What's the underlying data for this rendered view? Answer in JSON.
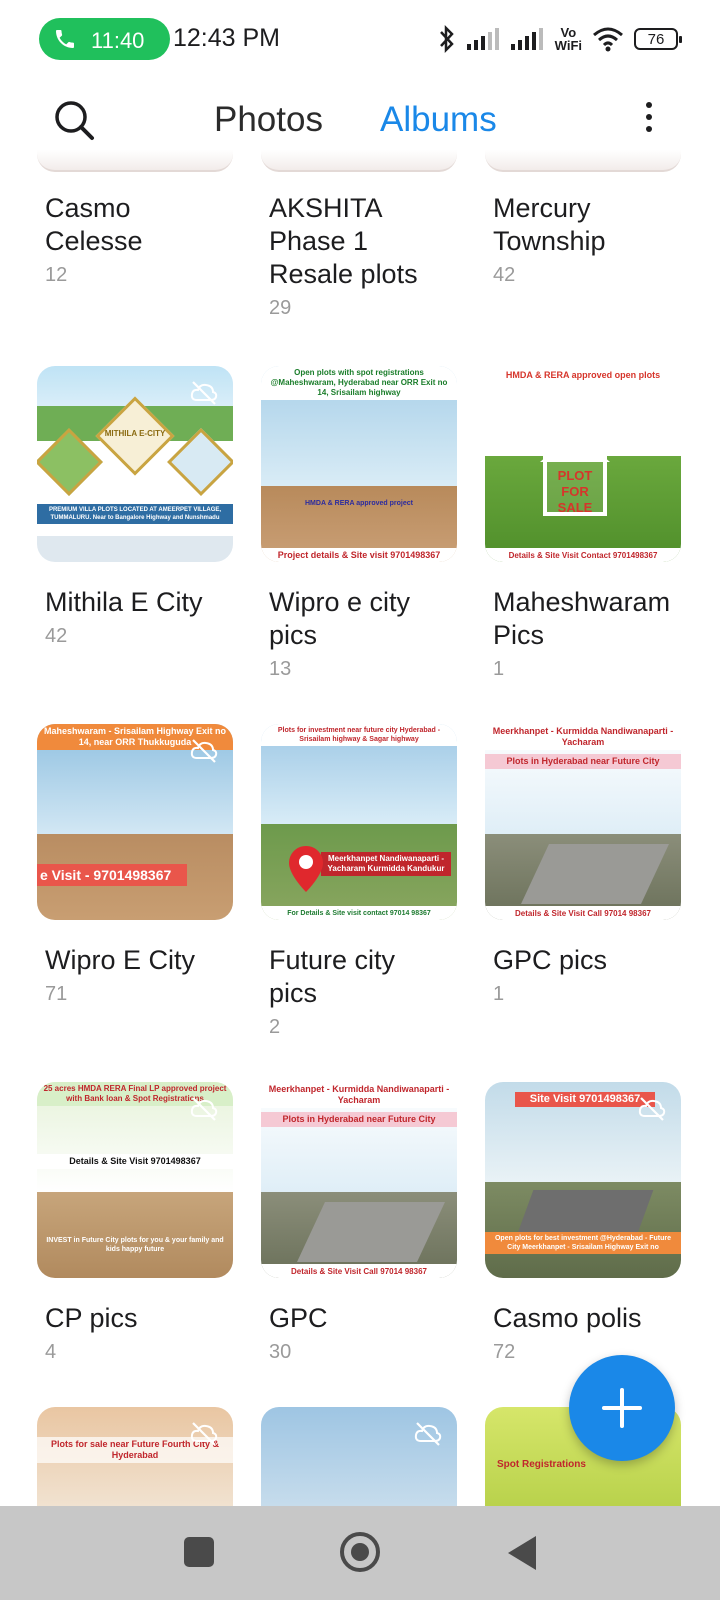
{
  "status_bar": {
    "call_time": "11:40",
    "clock": "12:43 PM",
    "vowifi_top": "Vo",
    "vowifi_bottom": "WiFi",
    "battery": "76"
  },
  "header": {
    "tab_photos": "Photos",
    "tab_albums": "Albums"
  },
  "albums_top_partial": [
    {
      "name": "Casmo\nCelesse",
      "count": "12"
    },
    {
      "name": "AKSHITA\nPhase 1\nResale plots",
      "count": "29"
    },
    {
      "name": "Mercury\nTownship",
      "count": "42"
    }
  ],
  "albums": [
    {
      "name": "Mithila E City",
      "count": "42",
      "thumb": {
        "top": "",
        "mid": "MITHILA E-CITY",
        "bottom": "PREMIUM VILLA PLOTS LOCATED AT AMEERPET VILLAGE, TUMMALURU. Near to Bangalore Highway and Nunshmadu"
      }
    },
    {
      "name": "Wipro e city\npics",
      "count": "13",
      "thumb": {
        "top": "Open plots with spot registrations @Maheshwaram, Hyderabad near ORR Exit no 14, Srisailam highway",
        "mid": "HMDA & RERA approved project",
        "bottom": "Project details & Site visit 9701498367"
      }
    },
    {
      "name": "Maheshwaram\nPics",
      "count": "1",
      "thumb": {
        "top": "HMDA & RERA approved open plots",
        "mid": "PLOT FOR SALE",
        "bottom": "Details & Site Visit Contact 9701498367"
      }
    },
    {
      "name": "Wipro E City",
      "count": "71",
      "thumb": {
        "top": "Maheshwaram - Srisailam Highway Exit no 14, near ORR Thukkuguda",
        "mid": "",
        "bottom": "e Visit - 9701498367"
      }
    },
    {
      "name": "Future city\npics",
      "count": "2",
      "thumb": {
        "top": "Plots for investment near future city Hyderabad - Srisailam highway & Sagar highway",
        "mid": "Meerkhanpet Nandiwanaparti - Yacharam Kurmidda Kandukur",
        "bottom": "For Details & Site visit contact 97014 98367"
      }
    },
    {
      "name": "GPC pics",
      "count": "1",
      "thumb": {
        "top": "Meerkhanpet - Kurmidda Nandiwanaparti - Yacharam",
        "mid": "Plots in Hyderabad near Future City",
        "bottom": "Details & Site Visit Call 97014 98367"
      }
    },
    {
      "name": "CP pics",
      "count": "4",
      "thumb": {
        "top": "25 acres HMDA RERA Final LP approved project with Bank loan & Spot Registrations",
        "mid": "Details & Site Visit 9701498367",
        "bottom": "INVEST in Future City plots for you & your family and kids happy future"
      }
    },
    {
      "name": "GPC",
      "count": "30",
      "thumb": {
        "top": "Meerkhanpet - Kurmidda Nandiwanaparti - Yacharam",
        "mid": "Plots in Hyderabad near Future City",
        "bottom": "Details & Site Visit Call 97014 98367"
      }
    },
    {
      "name": "Casmo polis",
      "count": "72",
      "thumb": {
        "top": "Site Visit 9701498367",
        "mid": "",
        "bottom": "Open plots for best investment @Hyderabad - Future City Meerkhanpet - Srisailam Highway Exit no"
      }
    }
  ],
  "albums_bottom_partial": [
    {
      "thumb_text": "Plots for sale near Future Fourth City & Hyderabad"
    },
    {
      "thumb_text": ""
    },
    {
      "thumb_text": "Spot Registrations"
    }
  ],
  "colors": {
    "accent": "#1a88e8",
    "call_pill": "#20c05c",
    "navbar": "#c7c7c7"
  },
  "icons": [
    "phone-icon",
    "bluetooth-icon",
    "signal-icon",
    "wifi-icon",
    "search-icon",
    "more-vert-icon",
    "cloud-off-icon",
    "add-icon"
  ]
}
